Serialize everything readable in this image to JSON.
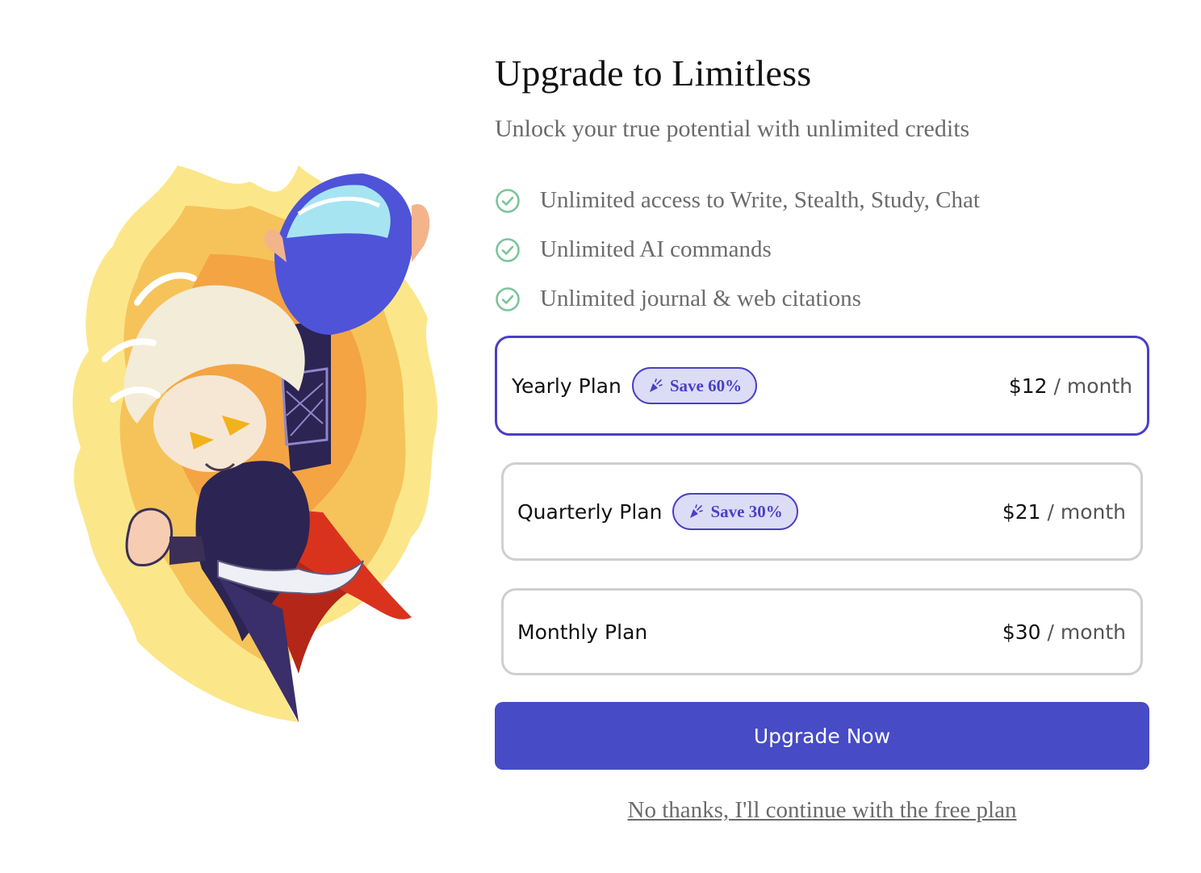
{
  "header": {
    "title": "Upgrade to Limitless",
    "subtitle": "Unlock your true potential with unlimited credits"
  },
  "features": [
    {
      "icon": "check-circle-icon",
      "text": "Unlimited access to Write, Stealth, Study, Chat"
    },
    {
      "icon": "check-circle-icon",
      "text": "Unlimited AI commands"
    },
    {
      "icon": "check-circle-icon",
      "text": "Unlimited journal & web citations"
    }
  ],
  "plans": [
    {
      "name": "Yearly Plan",
      "badge": "Save 60%",
      "badge_icon": "party-popper-icon",
      "amount": "$12",
      "per": "/ month",
      "selected": true
    },
    {
      "name": "Quarterly Plan",
      "badge": "Save 30%",
      "badge_icon": "party-popper-icon",
      "amount": "$21",
      "per": "/ month",
      "selected": false
    },
    {
      "name": "Monthly Plan",
      "amount": "$30",
      "per": "/ month",
      "selected": false
    }
  ],
  "cta": {
    "label": "Upgrade Now"
  },
  "decline": {
    "label": "No thanks, I'll continue with the free plan"
  },
  "colors": {
    "accent": "#474bc6",
    "accent_border": "#4a3fc6",
    "badge_bg": "#dcdcf6",
    "check_green": "#7cc59a",
    "muted_text": "#6b6b6b"
  },
  "illustration": {
    "icon": "hero-character-illustration"
  }
}
